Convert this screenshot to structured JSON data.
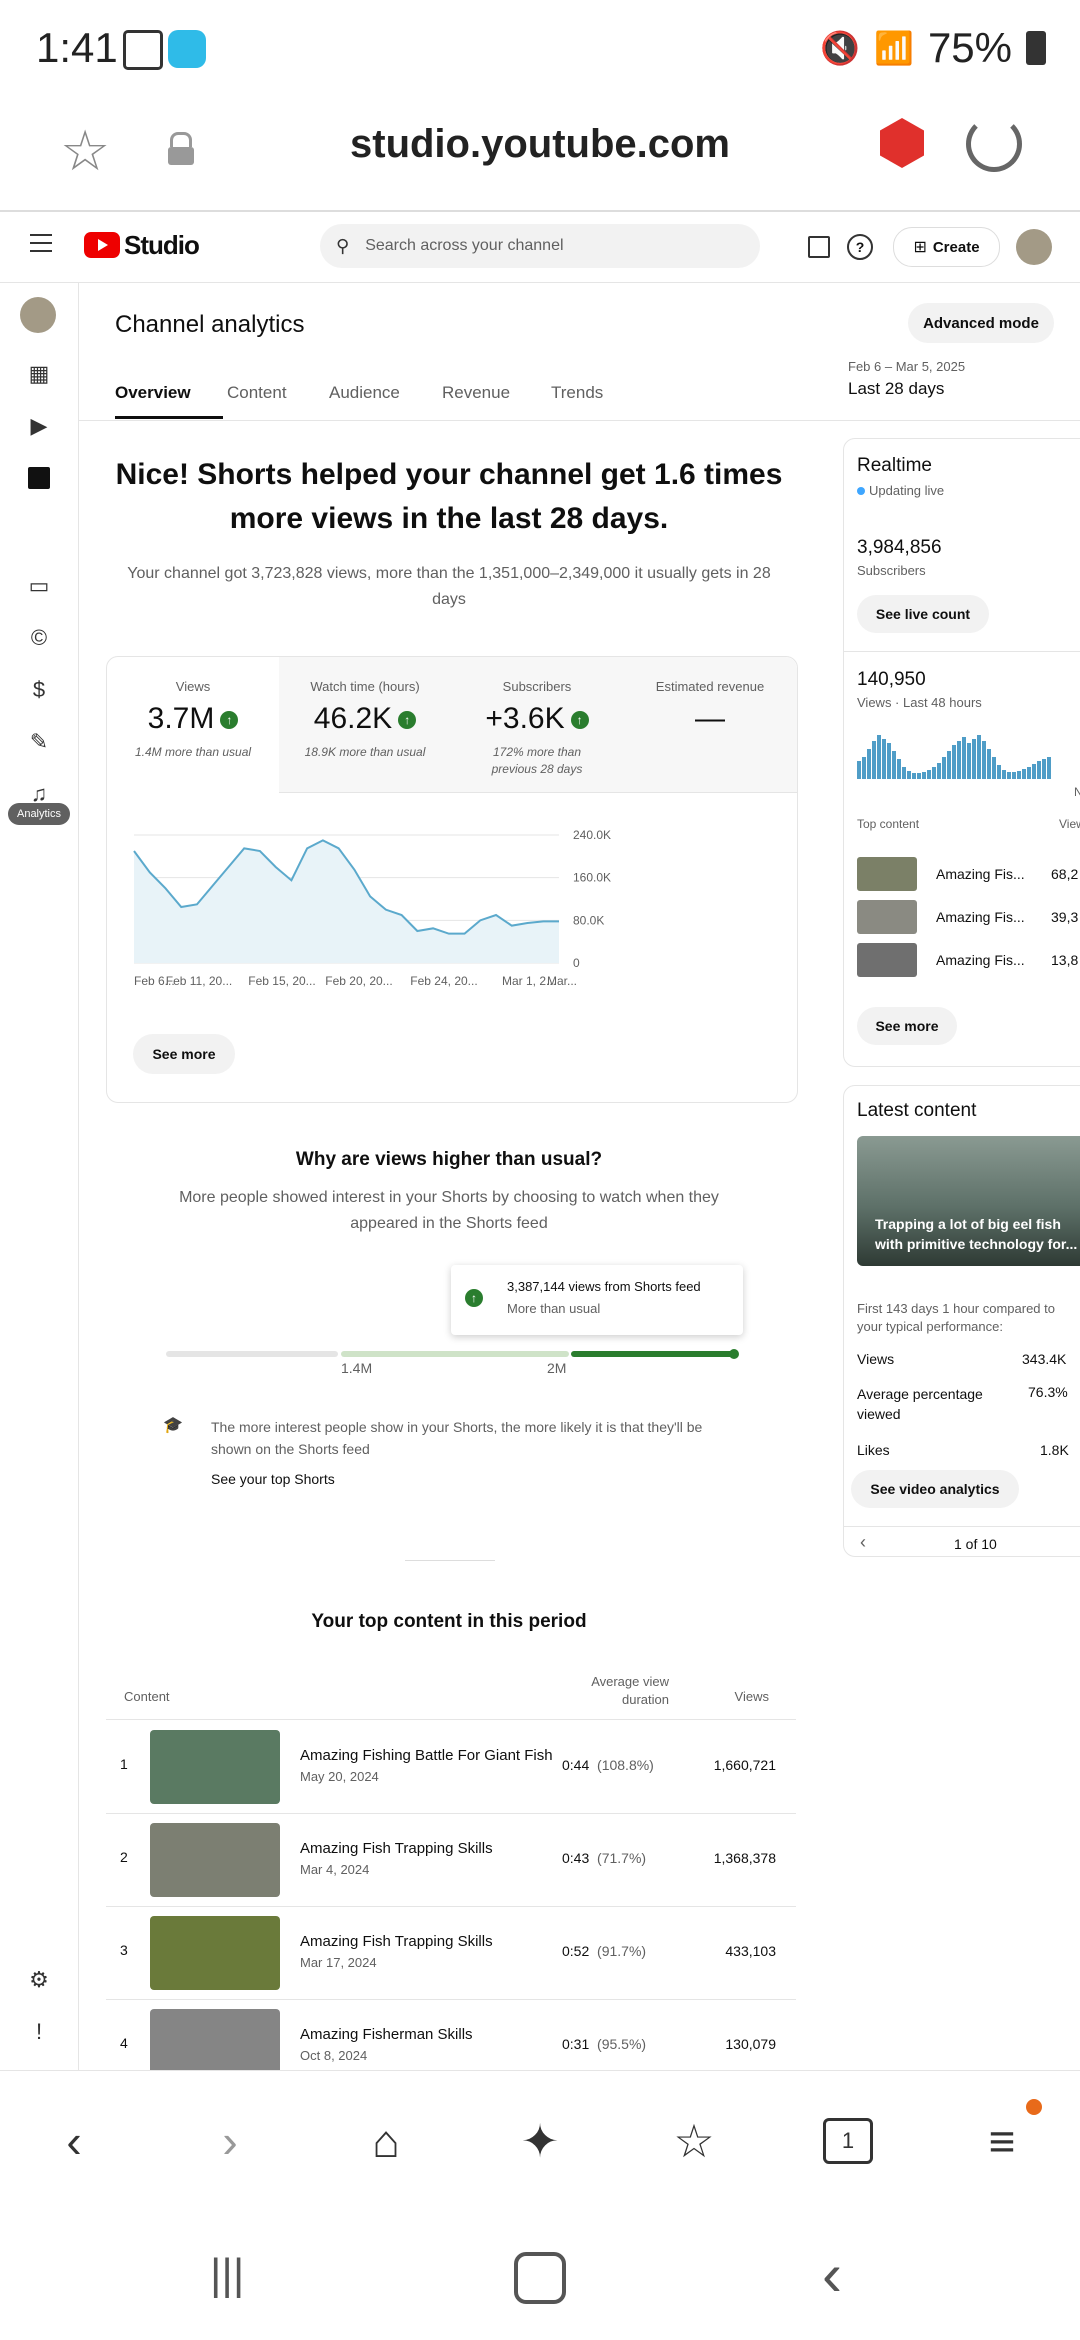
{
  "status": {
    "time": "1:41",
    "battery": "75%"
  },
  "browser": {
    "url": "studio.youtube.com"
  },
  "header": {
    "logo_text": "Studio",
    "search_placeholder": "Search across your channel",
    "create_label": "Create"
  },
  "sidebar": {
    "analytics_label": "Analytics"
  },
  "page": {
    "title": "Channel analytics",
    "advanced_label": "Advanced mode",
    "date_range": "Feb 6 – Mar 5, 2025",
    "date_label": "Last 28 days",
    "tabs": [
      "Overview",
      "Content",
      "Audience",
      "Revenue",
      "Trends"
    ]
  },
  "hero": {
    "headline_1": "Nice! Shorts helped your channel get 1.6 times",
    "headline_2": "more views in the last 28 days.",
    "sub_1": "Your channel got 3,723,828 views, more than the 1,351,000–2,349,000 it usually gets in 28",
    "sub_2": "days"
  },
  "metrics": [
    {
      "label": "Views",
      "value": "3.7M",
      "sub": "1.4M more than usual"
    },
    {
      "label": "Watch time (hours)",
      "value": "46.2K",
      "sub": "18.9K more than usual"
    },
    {
      "label": "Subscribers",
      "value": "+3.6K",
      "sub": "172% more than previous 28 days"
    },
    {
      "label": "Estimated revenue",
      "value": "—",
      "sub": ""
    }
  ],
  "chart_data": {
    "type": "area",
    "x": [
      "Feb 6",
      "Feb 7",
      "Feb 8",
      "Feb 9",
      "Feb 10",
      "Feb 11",
      "Feb 12",
      "Feb 13",
      "Feb 14",
      "Feb 15",
      "Feb 16",
      "Feb 17",
      "Feb 18",
      "Feb 19",
      "Feb 20",
      "Feb 21",
      "Feb 22",
      "Feb 23",
      "Feb 24",
      "Feb 25",
      "Feb 26",
      "Feb 27",
      "Feb 28",
      "Mar 1",
      "Mar 2",
      "Mar 3",
      "Mar 4",
      "Mar 5"
    ],
    "values": [
      210000,
      170000,
      140000,
      105000,
      110000,
      145000,
      180000,
      215000,
      210000,
      180000,
      155000,
      215000,
      230000,
      215000,
      175000,
      125000,
      100000,
      90000,
      60000,
      65000,
      55000,
      55000,
      80000,
      90000,
      70000,
      75000,
      78000,
      78000
    ],
    "ylim": [
      0,
      240000
    ],
    "y_ticks": [
      "240.0K",
      "160.0K",
      "80.0K",
      "0"
    ],
    "x_tick_labels": [
      "Feb 6...",
      "Feb 11, 20...",
      "Feb 15, 20...",
      "Feb 20, 20...",
      "Feb 24, 20...",
      "Mar 1, 2...",
      "Mar..."
    ]
  },
  "see_more": "See more",
  "why": {
    "title": "Why are views higher than usual?",
    "sub_1": "More people showed interest in your Shorts by choosing to watch when they",
    "sub_2": "appeared in the Shorts feed",
    "tip_value": "3,387,144 views from Shorts feed",
    "tip_sub": "More than usual",
    "mark_1": "1.4M",
    "mark_2": "2M",
    "note_1": "The more interest people show in your Shorts, the more likely it is that they'll be",
    "note_2": "shown on the Shorts feed",
    "link": "See your top Shorts"
  },
  "top": {
    "title": "Your top content in this period",
    "col_content": "Content",
    "col_avg_1": "Average view",
    "col_avg_2": "duration",
    "col_views": "Views",
    "rows": [
      {
        "n": "1",
        "title": "Amazing Fishing Battle For Giant Fish",
        "date": "May 20, 2024",
        "dur": "0:44",
        "pct": "(108.8%)",
        "views": "1,660,721",
        "color": "#5a7a62"
      },
      {
        "n": "2",
        "title": "Amazing Fish Trapping Skills",
        "date": "Mar 4, 2024",
        "dur": "0:43",
        "pct": "(71.7%)",
        "views": "1,368,378",
        "color": "#7c7f72"
      },
      {
        "n": "3",
        "title": "Amazing Fish Trapping Skills",
        "date": "Mar 17, 2024",
        "dur": "0:52",
        "pct": "(91.7%)",
        "views": "433,103",
        "color": "#6a7a3a"
      },
      {
        "n": "4",
        "title": "Amazing Fisherman Skills",
        "date": "Oct 8, 2024",
        "dur": "0:31",
        "pct": "(95.5%)",
        "views": "130,079",
        "color": "#858585"
      }
    ]
  },
  "realtime": {
    "title": "Realtime",
    "live": "Updating live",
    "subs": "3,984,856",
    "subs_label": "Subscribers",
    "live_btn": "See live count",
    "views": "140,950",
    "views_label": "Views · Last 48 hours",
    "no_label": "No",
    "top_label": "Top content",
    "top_views_label": "Views",
    "items": [
      {
        "title": "Amazing Fis...",
        "views": "68,2"
      },
      {
        "title": "Amazing Fis...",
        "views": "39,3"
      },
      {
        "title": "Amazing Fis...",
        "views": "13,8"
      }
    ],
    "see_more": "See more"
  },
  "latest": {
    "title": "Latest content",
    "video_1": "Trapping a lot of big eel fish",
    "video_2": "with primitive technology for...",
    "perf_1": "First 143 days 1 hour compared to",
    "perf_2": "your typical performance:",
    "stats": [
      {
        "label": "Views",
        "value": "343.4K"
      },
      {
        "label": "Average percentage viewed",
        "value": "76.3%"
      },
      {
        "label": "Likes",
        "value": "1.8K"
      }
    ],
    "btn": "See video analytics",
    "pager": "1 of 10"
  }
}
